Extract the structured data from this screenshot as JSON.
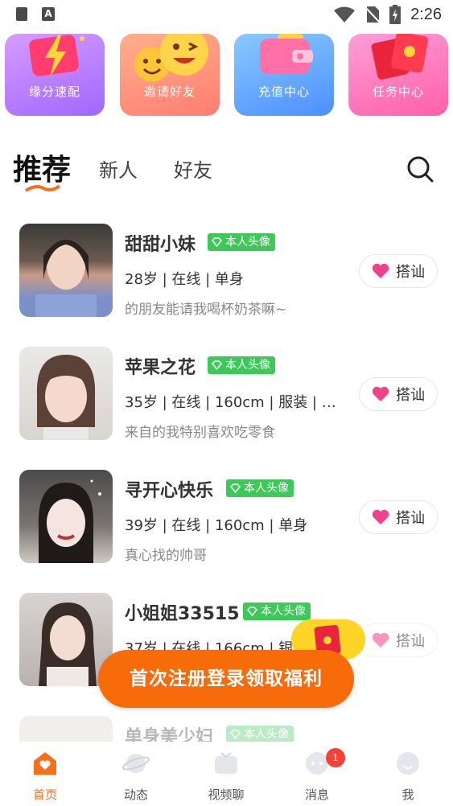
{
  "status_bar": {
    "time": "2:26",
    "left_icons": [
      "lock-icon",
      "a-icon"
    ],
    "right_icons": [
      "wifi-icon",
      "no-sim-icon",
      "battery-icon"
    ]
  },
  "feature_cards": [
    {
      "label": "缘分速配",
      "icon": "lightning-ticket-icon"
    },
    {
      "label": "邀请好友",
      "icon": "smiley-faces-icon"
    },
    {
      "label": "充值中心",
      "icon": "wallet-icon"
    },
    {
      "label": "任务中心",
      "icon": "red-envelope-icon"
    }
  ],
  "tabs": [
    {
      "label": "推荐",
      "active": true
    },
    {
      "label": "新人",
      "active": false
    },
    {
      "label": "好友",
      "active": false
    }
  ],
  "users": [
    {
      "name": "甜甜小妹",
      "badge": "本人头像",
      "info": "28岁 | 在线 | 单身",
      "bio": "的朋友能请我喝杯奶茶嘛~",
      "action": "搭讪"
    },
    {
      "name": "苹果之花",
      "badge": "本人头像",
      "info": "35岁 | 在线 | 160cm | 服装 | 单...",
      "bio": "来自的我特别喜欢吃零食",
      "action": "搭讪"
    },
    {
      "name": "寻开心快乐",
      "badge": "本人头像",
      "info": "39岁 | 在线 | 160cm | 单身",
      "bio": "真心找的帅哥",
      "action": "搭讪"
    },
    {
      "name": "小姐姐33515",
      "badge": "本人头像",
      "info": "37岁 | 在线 | 166cm | 银行...",
      "bio": "",
      "action": "搭讪"
    },
    {
      "name": "单身美少妇",
      "badge": "本人头像",
      "info": "",
      "bio": "",
      "action": ""
    }
  ],
  "promo_banner": {
    "label": "首次注册登录领取福利"
  },
  "bottom_nav": [
    {
      "label": "首页",
      "active": true,
      "icon": "home-icon"
    },
    {
      "label": "动态",
      "active": false,
      "icon": "planet-icon"
    },
    {
      "label": "视频聊",
      "active": false,
      "icon": "video-chat-icon"
    },
    {
      "label": "消息",
      "active": false,
      "icon": "message-icon",
      "badge": "1"
    },
    {
      "label": "我",
      "active": false,
      "icon": "profile-icon"
    }
  ],
  "colors": {
    "accent": "#f4701a",
    "badge_green": "#3ec85a",
    "heart": "#f0428a"
  }
}
